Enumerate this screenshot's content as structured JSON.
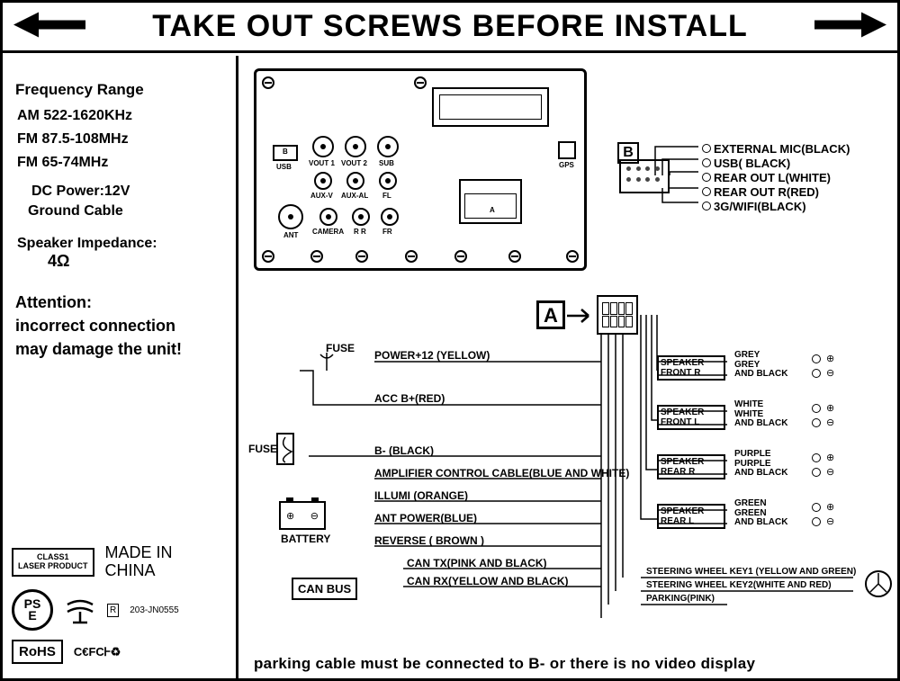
{
  "header": "TAKE OUT SCREWS BEFORE INSTALL",
  "left": {
    "freq_title": "Frequency Range",
    "am": "AM 522-1620KHz",
    "fm1": "FM 87.5-108MHz",
    "fm2": "FM 65-74MHz",
    "dc": "DC Power:12V",
    "ground": "Ground Cable",
    "sp_imp": "Speaker Impedance:",
    "ohm": "4Ω",
    "attn1": "Attention:",
    "attn2": "incorrect connection",
    "attn3": "may damage the unit!",
    "class1_l1": "CLASS1",
    "class1_l2": "LASER PRODUCT",
    "madein_l1": "MADE IN",
    "madein_l2": "CHINA",
    "rohs": "RoHS",
    "certs": "C€FCᎰ♻",
    "pse1": "PS",
    "pse2": "E",
    "rbox": "R",
    "rcode": "203-JN0555"
  },
  "unit": {
    "usb_b": "B",
    "usb": "USB",
    "vout1": "VOUT 1",
    "vout2": "VOUT 2",
    "sub": "SUB",
    "auxv": "AUX-V",
    "auxal": "AUX-AL",
    "fl": "FL",
    "ant": "ANT",
    "camera": "CAMERA",
    "rr": "R R",
    "fr": "FR",
    "gps": "GPS",
    "a": "A"
  },
  "b": {
    "label": "B",
    "w1": "EXTERNAL MIC(BLACK)",
    "w2": "USB( BLACK)",
    "w3": "REAR OUT L(WHITE)",
    "w4": "REAR OUT R(RED)",
    "w5": "3G/WIFI(BLACK)"
  },
  "a": {
    "label": "A"
  },
  "wires": {
    "fuse": "FUSE",
    "w1": "POWER+12 (YELLOW)",
    "w2": "ACC B+(RED)",
    "fuse2": "FUSE",
    "w3": "B- (BLACK)",
    "w4": "AMPLIFIER CONTROL CABLE(BLUE AND WHITE)",
    "w5": "ILLUMI (ORANGE)",
    "w6": "ANT POWER(BLUE)",
    "w7": "REVERSE ( BROWN )",
    "w8": "CAN TX(PINK AND BLACK)",
    "w9": "CAN RX(YELLOW AND BLACK)",
    "battery": "BATTERY",
    "canbus": "CAN BUS",
    "sw1": "STEERING WHEEL KEY1 (YELLOW AND GREEN)",
    "sw2": "STEERING WHEEL KEY2(WHITE AND RED)",
    "parking": "PARKING(PINK)"
  },
  "speakers": {
    "fr_box_l1": "SPEAKER",
    "fr_box_l2": "FRONT   R",
    "fr_c1": "GREY",
    "fr_c2": "GREY",
    "fr_c3": "AND BLACK",
    "fl_box_l1": "SPEAKER",
    "fl_box_l2": "FRONT   L",
    "fl_c1": "WHITE",
    "fl_c2": "WHITE",
    "fl_c3": "AND BLACK",
    "rr_box_l1": "SPEAKER",
    "rr_box_l2": "REAR    R",
    "rr_c1": "PURPLE",
    "rr_c2": "PURPLE",
    "rr_c3": "AND BLACK",
    "rl_box_l1": "SPEAKER",
    "rl_box_l2": "REAR    L",
    "rl_c1": "GREEN",
    "rl_c2": "GREEN",
    "rl_c3": "AND BLACK"
  },
  "bottom": "parking cable must be connected to B- or there is no video display"
}
